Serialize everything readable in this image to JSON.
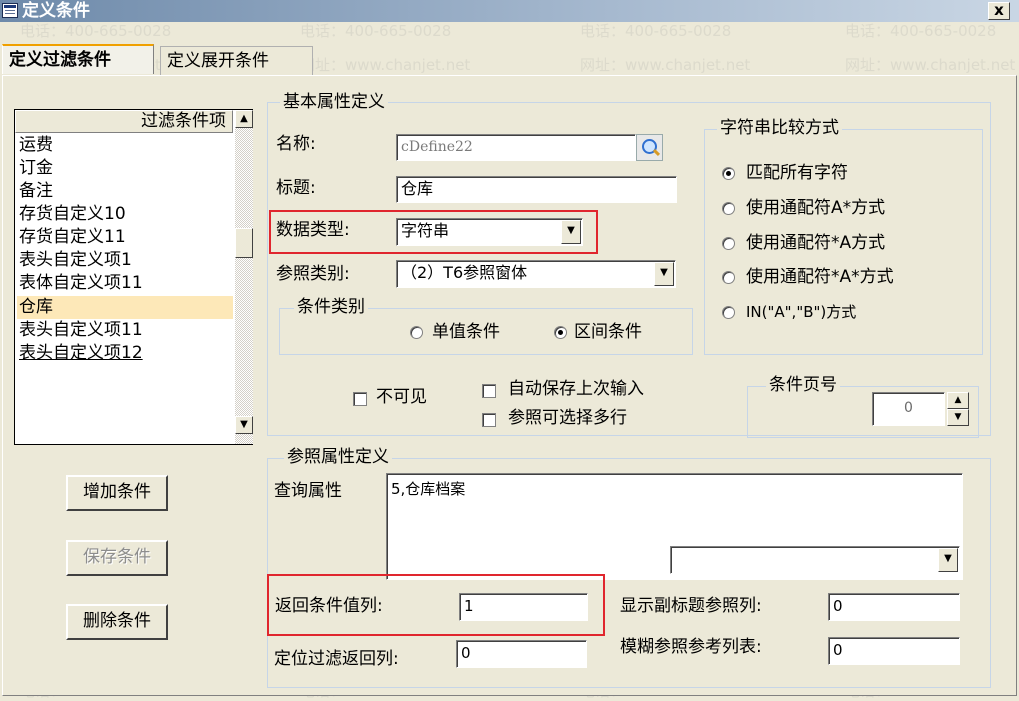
{
  "window": {
    "title": "定义条件",
    "close_label": "x"
  },
  "tabs": [
    {
      "label": "定义过滤条件"
    },
    {
      "label": "定义展开条件"
    }
  ],
  "filter_list": {
    "header": "过滤条件项",
    "items": [
      "运费",
      "订金",
      "备注",
      "存货自定义10",
      "存货自定义11",
      "表头自定义项1",
      "表体自定义项11",
      "仓库",
      "表头自定义项11",
      "表头自定义项12"
    ],
    "selected_index": 7
  },
  "buttons": {
    "add": "增加条件",
    "save": "保存条件",
    "delete": "删除条件"
  },
  "basic": {
    "group_title": "基本属性定义",
    "name_label": "名称:",
    "name_value": "cDefine22",
    "caption_label": "标题:",
    "caption_value": "仓库",
    "datatype_label": "数据类型:",
    "datatype_value": "字符串",
    "ref_label": "参照类别:",
    "ref_value": "（2）T6参照窗体",
    "cond_group_title": "条件类别",
    "single_label": "单值条件",
    "range_label": "区间条件",
    "invisible_label": "不可见",
    "autosave_label": "自动保存上次输入",
    "multi_label": "参照可选择多行"
  },
  "compare": {
    "title": "字符串比较方式",
    "options": [
      "匹配所有字符",
      "使用通配符A*方式",
      "使用通配符*A方式",
      "使用通配符*A*方式",
      "IN(\"A\",\"B\")方式"
    ],
    "selected_index": 0
  },
  "page": {
    "title": "条件页号",
    "value": "0"
  },
  "ref_props": {
    "group_title": "参照属性定义",
    "query_label": "查询属性",
    "query_value": "5,仓库档案",
    "return_label": "返回条件值列:",
    "return_value": "1",
    "subtitle_label": "显示副标题参照列:",
    "subtitle_value": "0",
    "locate_label": "定位过滤返回列:",
    "locate_value": "0",
    "fuzzy_label": "模糊参照参考列表:",
    "fuzzy_value": "0"
  },
  "watermark": {
    "phone": "电话：400-665-0028",
    "site": "网址：www.chanjet.net"
  },
  "colors": {
    "title_gradient_start": "#6e8aaa",
    "highlight_red": "#e0262e",
    "selected_row": "#fde8b8",
    "tab_accent": "#f0a000"
  }
}
